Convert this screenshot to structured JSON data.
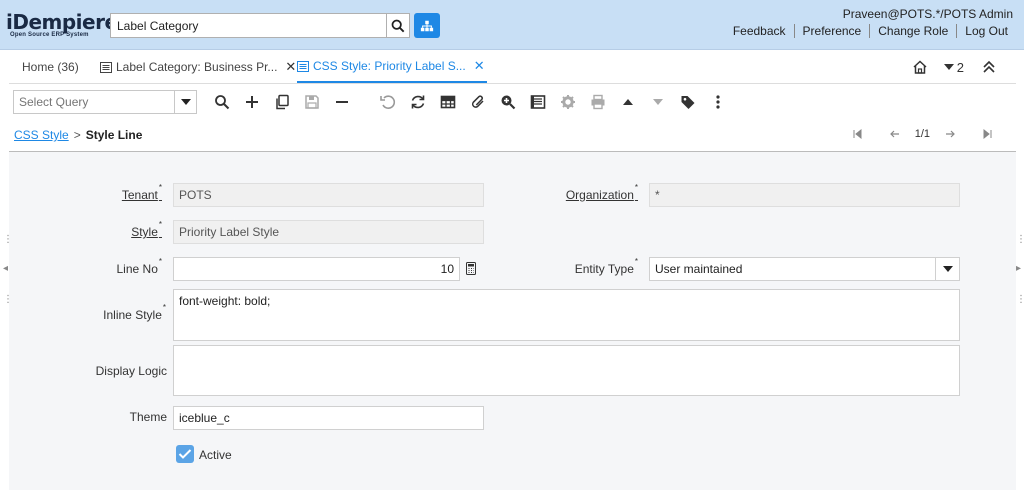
{
  "header": {
    "logo_main": "iDempiere",
    "logo_sub": "Open Source ERP System",
    "search_value": "Label Category",
    "user": "Praveen@POTS.*/POTS Admin",
    "links": [
      "Feedback",
      "Preference",
      "Change Role",
      "Log Out"
    ]
  },
  "tabs": [
    {
      "label": "Home (36)",
      "closable": false,
      "active": false
    },
    {
      "label": "Label Category: Business Pr...",
      "closable": true,
      "active": false
    },
    {
      "label": "CSS Style: Priority Label S...",
      "closable": true,
      "active": true
    }
  ],
  "tab_controls": {
    "count": "2"
  },
  "toolbar": {
    "query_placeholder": "Select Query"
  },
  "breadcrumb": {
    "parent": "CSS Style",
    "separator": ">",
    "current": "Style Line"
  },
  "navigation": {
    "record": "1/1"
  },
  "form": {
    "tenant_label": "Tenant",
    "tenant_value": "POTS",
    "organization_label": "Organization",
    "organization_value": "*",
    "style_label": "Style",
    "style_value": "Priority Label Style",
    "line_no_label": "Line No",
    "line_no_value": "10",
    "entity_type_label": "Entity Type",
    "entity_type_value": "User maintained",
    "inline_style_label": "Inline Style",
    "inline_style_value": "font-weight: bold;",
    "display_logic_label": "Display Logic",
    "display_logic_value": "",
    "theme_label": "Theme",
    "theme_value": "iceblue_c",
    "active_label": "Active",
    "active_checked": true,
    "required_mark": "*"
  },
  "colors": {
    "accent": "#1e88e5",
    "header_bg": "#c8dff5"
  }
}
